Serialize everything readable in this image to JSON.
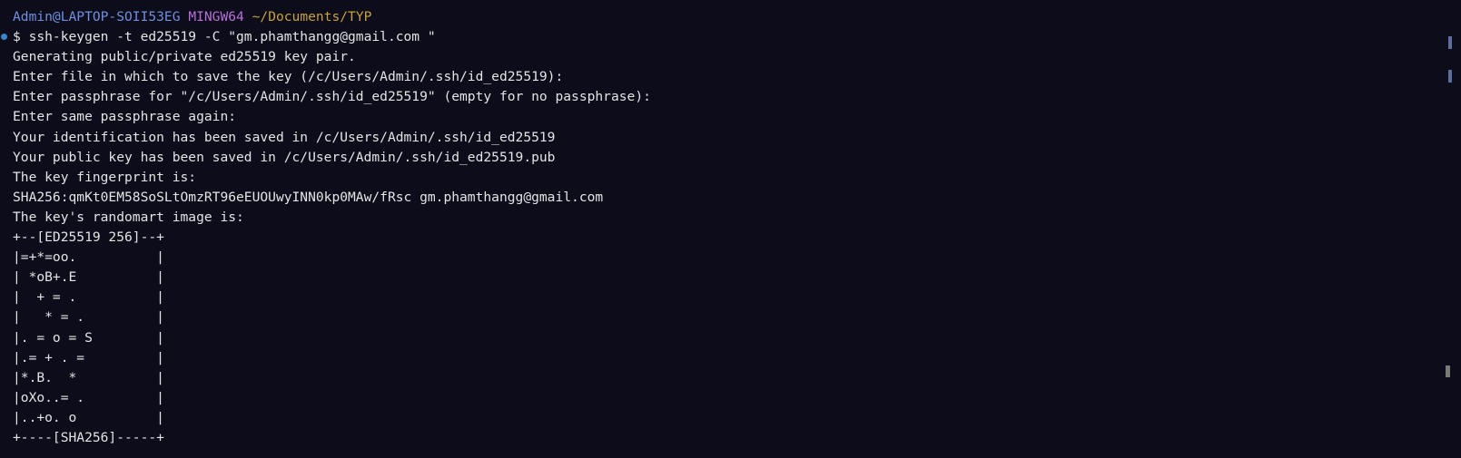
{
  "prompt": {
    "user_host": "Admin@LAPTOP-SOII53EG",
    "system": "MINGW64",
    "path": "~/Documents/TYP"
  },
  "command": "$ ssh-keygen -t ed25519 -C \"gm.phamthangg@gmail.com \"",
  "output": [
    "Generating public/private ed25519 key pair.",
    "Enter file in which to save the key (/c/Users/Admin/.ssh/id_ed25519):",
    "Enter passphrase for \"/c/Users/Admin/.ssh/id_ed25519\" (empty for no passphrase):",
    "Enter same passphrase again:",
    "Your identification has been saved in /c/Users/Admin/.ssh/id_ed25519",
    "Your public key has been saved in /c/Users/Admin/.ssh/id_ed25519.pub",
    "The key fingerprint is:",
    "SHA256:qmKt0EM58SoSLtOmzRT96eEUOUwyINN0kp0MAw/fRsc gm.phamthangg@gmail.com",
    "The key's randomart image is:"
  ],
  "randomart": [
    "+--[ED25519 256]--+",
    "|=+*=oo.          |",
    "| *oB+.E          |",
    "|  + = .          |",
    "|   * = .         |",
    "|. = o = S        |",
    "|.= + . =         |",
    "|*.B.  *          |",
    "|oXo..= .         |",
    "|..+o. o          |",
    "+----[SHA256]-----+"
  ],
  "colors": {
    "background": "#0c0c1b",
    "text": "#e4e4e4",
    "user_host": "#6f8fe0",
    "system": "#b76fd9",
    "path": "#c7a23a",
    "command_marker": "#3a86c8",
    "scroll_marker": "#5b6e9c",
    "scroll_marker_thumb": "#7a7a7a"
  }
}
